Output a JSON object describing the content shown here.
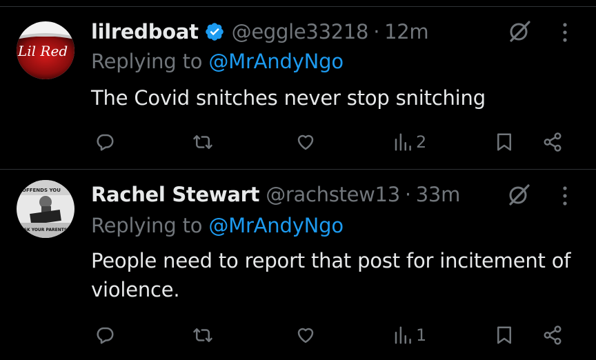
{
  "tweets": [
    {
      "display_name": "lilredboat",
      "handle": "@eggle33218",
      "separator": "·",
      "time": "12m",
      "replying_prefix": "Replying to",
      "replying_to": "@MrAndyNgo",
      "text": "The Covid snitches never stop snitching",
      "views": "2",
      "avatar_text": "Lil Red",
      "verified": true
    },
    {
      "display_name": "Rachel Stewart",
      "handle": "@rachstew13",
      "separator": "·",
      "time": "33m",
      "replying_prefix": "Replying to",
      "replying_to": "@MrAndyNgo",
      "text": "People need to report that post for incitement of violence.",
      "views": "1",
      "avatar_text_top": "OFFENDS YOU",
      "avatar_text_bottom": "ASK YOUR PARENTS",
      "verified": false
    }
  ],
  "colors": {
    "background": "#000000",
    "text_primary": "#e7e9ea",
    "text_secondary": "#71767b",
    "link": "#1d9bf0",
    "divider": "#2f3336"
  },
  "icons": [
    "verified-badge-icon",
    "grok-icon",
    "more-icon",
    "reply-icon",
    "repost-icon",
    "like-icon",
    "views-icon",
    "bookmark-icon",
    "share-icon"
  ]
}
